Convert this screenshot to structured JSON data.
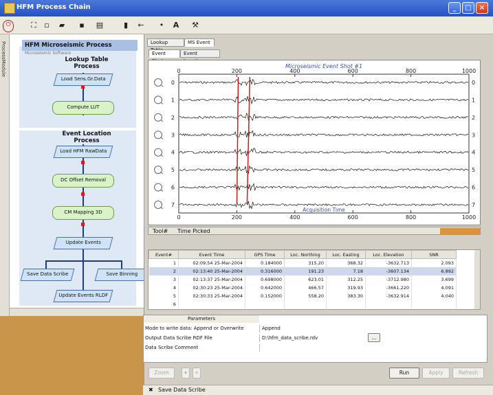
{
  "window": {
    "title": "HFM Process Chain"
  },
  "toolbar": {
    "bold_a": "A"
  },
  "left_tab": "ProcessModule",
  "tree": {
    "header": "HFM Microseismic Process",
    "sub_header": "Microseismic Software",
    "lookup_title": "Lookup Table Process",
    "lookup_nodes": [
      "Load Sens.Gr.Data",
      "Compute LUT"
    ],
    "event_title": "Event Location Process",
    "event_nodes": [
      "Load HFM RawData",
      "DC Offset Removal",
      "CM Mapping 3D",
      "Update Events"
    ],
    "branch_nodes": [
      "Save Data Scribe",
      "Save Binning"
    ],
    "final_node": "Update Events RLDF"
  },
  "tabs": {
    "top": [
      "Lookup Table",
      "MS Event"
    ],
    "sub": [
      "Event Shot",
      "Event Location"
    ]
  },
  "chart_data": {
    "type": "line",
    "title": "Microseismic Event Shot #1",
    "xlabel": "Acquisition Time",
    "xlim": [
      0,
      1000
    ],
    "x_ticks": [
      0,
      200,
      400,
      600,
      800,
      1000
    ],
    "traces": [
      0,
      1,
      2,
      3,
      4,
      5,
      6,
      7
    ],
    "p_arrival": 205,
    "s_arrival": 245
  },
  "grid_header": {
    "tool": "Tool#",
    "time": "Time Picked"
  },
  "events_table": {
    "columns": [
      "Event#",
      "Event Time",
      "GPS Time",
      "Loc. Northing",
      "Loc. Easting",
      "Loc. Elevation",
      "SNR"
    ],
    "rows": [
      [
        "1",
        "02:09:54 25-Mar-2004",
        "0.184000",
        "315.20",
        "368.32",
        "-3632.713",
        "2.093"
      ],
      [
        "2",
        "02:13:40 25-Mar-2004",
        "0.316000",
        "191.23",
        "7.18",
        "-3607.134",
        "6.892"
      ],
      [
        "3",
        "02:13:37 25-Mar-2004",
        "0.698000",
        "623.01",
        "312.25",
        "-3712.980",
        "3.699"
      ],
      [
        "4",
        "02:30:23 25-Mar-2004",
        "0.642000",
        "466.57",
        "319.93",
        "-3661.220",
        "4.091"
      ],
      [
        "5",
        "02:30:33 25-Mar-2004",
        "0.152000",
        "558.20",
        "383.30",
        "-3632.914",
        "4.040"
      ],
      [
        "6",
        "",
        "",
        "",
        "",
        "",
        ""
      ]
    ]
  },
  "params": {
    "title": "Parameters",
    "rows": [
      {
        "label": "Mode to write data: Append or Overwrite",
        "value": "Append"
      },
      {
        "label": "Output Data Scribe RDF File",
        "value": "D:\\hfm_data_scribe.rdv"
      },
      {
        "label": "Data Scribe Comment",
        "value": ""
      }
    ],
    "browse": "..."
  },
  "controls": {
    "zoom": "Zoom",
    "run": "Run",
    "apply": "Apply",
    "refresh": "Refresh"
  },
  "status": {
    "text": "Save Data Scribe"
  }
}
